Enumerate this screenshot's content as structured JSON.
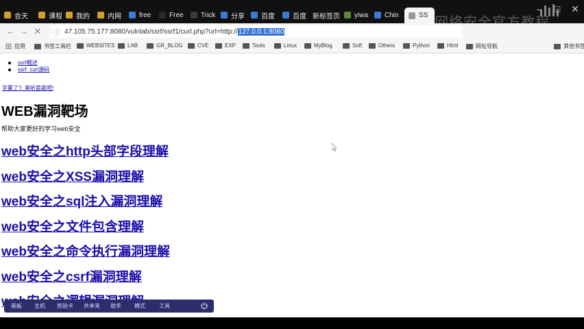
{
  "browser": {
    "tabs": [
      {
        "label": "合天",
        "fav": "#d0a030"
      },
      {
        "label": "课程",
        "fav": "#d0a030"
      },
      {
        "label": "我的",
        "fav": "#d0a030"
      },
      {
        "label": "内网",
        "fav": "#d0a030"
      },
      {
        "label": "free",
        "fav": "#3a7bd5"
      },
      {
        "label": "Free",
        "fav": "#2a2a2a"
      },
      {
        "label": "Trick",
        "fav": "#3a3a3a"
      },
      {
        "label": "分享",
        "fav": "#3a7bd5"
      },
      {
        "label": "百度",
        "fav": "#3a7bd5"
      },
      {
        "label": "百度",
        "fav": "#3a7bd5"
      },
      {
        "label": "新标签页",
        "fav": ""
      },
      {
        "label": "yiwa",
        "fav": "#5b8a3a"
      },
      {
        "label": "Chin",
        "fav": "#3a7bd5"
      },
      {
        "label": "SS",
        "fav": "#999999"
      }
    ],
    "overlay_title": "网络安全官方教程",
    "url_prefix": "47.105.75.177:8080/vulnlab/ssrf/ssrf1/curl.php?url=http://",
    "url_selected": "127.0.0.1:8080",
    "bookmarks": [
      {
        "label": "应用",
        "kind": "apps"
      },
      {
        "label": "书签工具栏",
        "kind": "folder"
      },
      {
        "label": "WEBSITES",
        "kind": "folder"
      },
      {
        "label": "LAB",
        "kind": "folder"
      },
      {
        "label": "GR_BLOG",
        "kind": "folder"
      },
      {
        "label": "CVE",
        "kind": "folder"
      },
      {
        "label": "EXP",
        "kind": "folder"
      },
      {
        "label": "Tools",
        "kind": "folder"
      },
      {
        "label": "Linux",
        "kind": "folder"
      },
      {
        "label": "MyBlog",
        "kind": "folder"
      },
      {
        "label": "Soft",
        "kind": "folder"
      },
      {
        "label": "Others",
        "kind": "folder"
      },
      {
        "label": "Python",
        "kind": "folder"
      },
      {
        "label": "Html",
        "kind": "folder"
      },
      {
        "label": "网址导航",
        "kind": "folder"
      },
      {
        "label": "其他书签",
        "kind": "folder"
      }
    ]
  },
  "page": {
    "top_links": [
      "ssrf概述",
      "ssrf_curl源码"
    ],
    "learn_link": "学累了?, 来听首歌吧!",
    "title": "WEB漏洞靶场",
    "subtitle": "帮助大家更好的学习web安全",
    "topics": [
      "web安全之http头部字段理解",
      "web安全之XSS漏洞理解",
      "web安全之sql注入漏洞理解",
      "web安全之文件包含理解",
      "web安全之命令执行漏洞理解",
      "web安全之csrf漏洞理解",
      "web安全之逻辑漏洞理解"
    ]
  },
  "taskbar": {
    "items": [
      "画板",
      "主机",
      "剪贴卡",
      "共享夹",
      "助手",
      "模式",
      "工具"
    ]
  }
}
